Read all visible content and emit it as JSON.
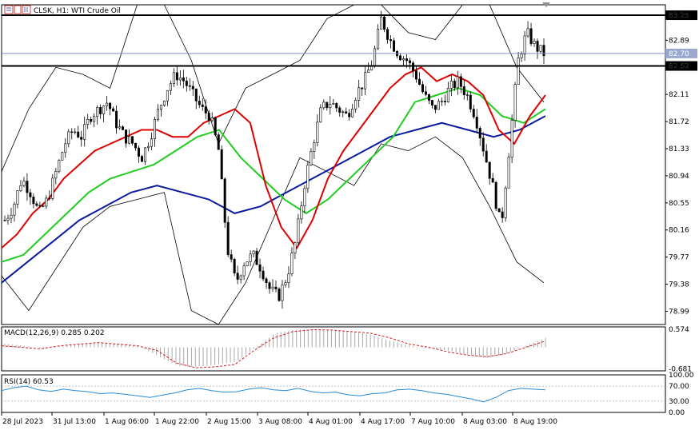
{
  "header": {
    "symbol": "CLSK, H1: WTI Crude Oil",
    "icon": "chart-type-icon"
  },
  "chart_data": [
    {
      "type": "candlestick",
      "panel": "price",
      "y_ticks": [
        "83.25",
        "82.89",
        "82.52",
        "82.11",
        "81.72",
        "81.33",
        "80.94",
        "80.55",
        "80.16",
        "79.77",
        "79.38",
        "78.99"
      ],
      "ylim": [
        78.8,
        83.4
      ],
      "x_labels": [
        "28 Jul 2023",
        "31 Jul 13:00",
        "1 Aug 06:00",
        "1 Aug 22:00",
        "2 Aug 15:00",
        "3 Aug 08:00",
        "4 Aug 01:00",
        "4 Aug 17:00",
        "7 Aug 10:00",
        "8 Aug 03:00",
        "8 Aug 19:00"
      ],
      "current_price": "82.70",
      "horizontal_levels": [
        {
          "value": 83.25,
          "label": "83.25"
        },
        {
          "value": 82.52,
          "label": "82.52"
        }
      ],
      "colors": {
        "ma_fast": "#e00000",
        "ma_mid": "#22cc22",
        "ma_slow": "#0a1aa0",
        "bands": "#000000",
        "candles": "#000000",
        "current_line": "#8090c0"
      },
      "series": [
        {
          "name": "",
          "type": "moving-average-fast"
        },
        {
          "name": "",
          "type": "moving-average-mid"
        },
        {
          "name": "",
          "type": "moving-average-slow"
        },
        {
          "name": "",
          "type": "bollinger-bands"
        }
      ],
      "close_path": [
        80.3,
        80.5,
        80.9,
        80.7,
        80.4,
        80.6,
        81.0,
        81.4,
        81.6,
        81.5,
        81.8,
        81.9,
        82.0,
        81.7,
        81.5,
        81.4,
        81.2,
        81.5,
        81.9,
        82.2,
        82.4,
        82.3,
        82.1,
        81.9,
        81.8,
        81.3,
        79.9,
        79.4,
        79.7,
        79.8,
        79.6,
        79.3,
        79.2,
        79.5,
        80.0,
        80.8,
        81.4,
        81.9,
        82.0,
        81.9,
        81.8,
        82.1,
        82.3,
        82.6,
        83.2,
        82.9,
        82.7,
        82.6,
        82.4,
        82.1,
        81.9,
        82.0,
        82.2,
        82.3,
        82.1,
        81.8,
        81.3,
        80.8,
        80.2,
        81.4,
        82.6,
        83.0,
        82.8,
        82.7
      ],
      "ma_fast_path": [
        79.9,
        80.1,
        80.4,
        80.6,
        80.9,
        81.1,
        81.3,
        81.4,
        81.5,
        81.6,
        81.6,
        81.5,
        81.5,
        81.7,
        81.8,
        81.9,
        81.7,
        80.8,
        80.2,
        79.9,
        80.3,
        80.9,
        81.3,
        81.6,
        81.9,
        82.2,
        82.4,
        82.5,
        82.3,
        82.4,
        82.3,
        82.1,
        81.6,
        81.4,
        81.8,
        82.1
      ],
      "ma_mid_path": [
        79.7,
        79.8,
        80.1,
        80.4,
        80.7,
        80.9,
        81.0,
        81.1,
        81.3,
        81.5,
        81.6,
        81.2,
        80.9,
        80.6,
        80.4,
        80.6,
        80.9,
        81.2,
        81.5,
        82.0,
        82.1,
        82.2,
        82.1,
        81.8,
        81.7,
        81.9
      ],
      "ma_slow_path": [
        79.4,
        79.7,
        80.0,
        80.3,
        80.5,
        80.7,
        80.8,
        80.7,
        80.6,
        80.4,
        80.5,
        80.7,
        80.9,
        81.1,
        81.3,
        81.5,
        81.6,
        81.7,
        81.6,
        81.5,
        81.6,
        81.8
      ],
      "bb_upper_path": [
        81.0,
        81.9,
        82.5,
        82.4,
        82.2,
        83.6,
        84.0,
        82.6,
        81.4,
        82.2,
        82.4,
        82.6,
        83.2,
        83.4,
        83.5,
        83.0,
        82.9,
        83.6,
        83.8,
        82.5,
        82.0
      ],
      "bb_lower_path": [
        79.5,
        79.0,
        79.6,
        80.2,
        80.5,
        80.6,
        80.7,
        79.0,
        78.5,
        79.4,
        80.3,
        81.2,
        81.0,
        80.8,
        81.4,
        81.3,
        81.5,
        81.2,
        80.5,
        79.7,
        79.4
      ]
    },
    {
      "type": "histogram",
      "panel": "macd",
      "title": "MACD(12,26,9) 0.285 0.202",
      "y_ticks": [
        "0.574",
        "-0.681"
      ],
      "ylim": [
        -0.75,
        0.65
      ],
      "signal_path": [
        0.05,
        0.0,
        -0.05,
        0.05,
        0.1,
        0.15,
        0.1,
        0.05,
        -0.1,
        -0.5,
        -0.65,
        -0.62,
        -0.55,
        -0.1,
        0.3,
        0.5,
        0.56,
        0.55,
        0.5,
        0.45,
        0.3,
        0.1,
        0.0,
        -0.15,
        -0.25,
        -0.3,
        -0.2,
        0.0,
        0.2
      ],
      "histogram_path": [
        0.12,
        0.05,
        -0.05,
        0.05,
        0.1,
        0.14,
        0.12,
        0.02,
        -0.3,
        -0.6,
        -0.62,
        -0.55,
        -0.45,
        0.0,
        0.45,
        0.56,
        0.57,
        0.55,
        0.5,
        0.4,
        0.2,
        0.05,
        -0.05,
        -0.1,
        -0.25,
        -0.35,
        -0.2,
        0.05,
        0.3
      ]
    },
    {
      "type": "line",
      "panel": "rsi",
      "title": "RSI(14) 60.53",
      "y_ticks": [
        "100.00",
        "70.00",
        "30.00",
        "0.00"
      ],
      "ylim": [
        0,
        100
      ],
      "levels": [
        70,
        30
      ],
      "values": [
        58,
        66,
        70,
        60,
        56,
        62,
        58,
        55,
        50,
        52,
        48,
        44,
        40,
        46,
        52,
        60,
        64,
        58,
        54,
        55,
        62,
        66,
        60,
        58,
        64,
        56,
        52,
        54,
        47,
        44,
        50,
        52,
        60,
        62,
        58,
        52,
        48,
        42,
        36,
        28,
        40,
        58,
        64,
        62,
        60
      ]
    }
  ]
}
